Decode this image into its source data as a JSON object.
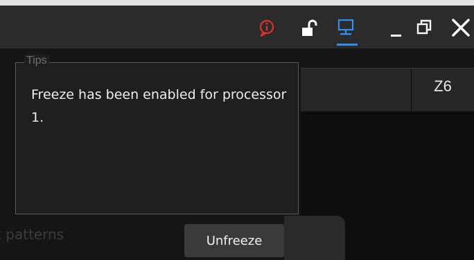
{
  "title_bar": {
    "icons": [
      "alert-icon",
      "unlock-icon",
      "monitor-icon",
      "minimize-icon",
      "restore-icon",
      "close-icon"
    ],
    "accent_color": "#2f8ff0",
    "alert_color": "#e03030"
  },
  "table": {
    "column_header": "Z6"
  },
  "background": {
    "faded_label": "t patterns"
  },
  "tips_dialog": {
    "legend": "Tips",
    "message": "Freeze has been enabled for processor 1.",
    "action_label": "Unfreeze"
  }
}
